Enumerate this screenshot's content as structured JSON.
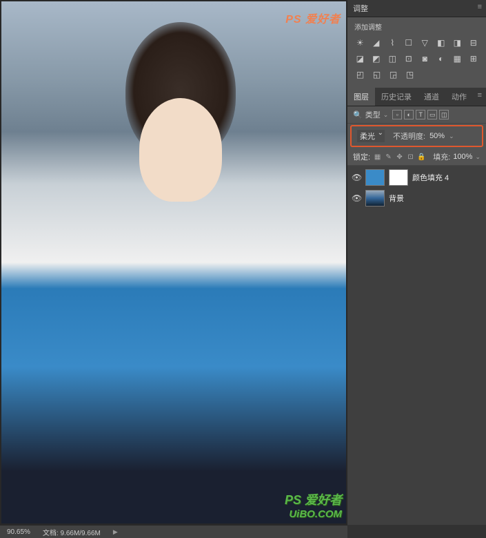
{
  "watermarks": {
    "top": "PS 爱好者",
    "mid": "PS 爱好者",
    "bottom": "UiBO.COM"
  },
  "adjustments": {
    "panel_title": "调整",
    "add_label": "添加调整",
    "icons_row1": [
      "brightness-icon",
      "levels-icon",
      "curves-icon",
      "exposure-icon",
      "vibrance-icon",
      "hue-icon",
      "bw-icon",
      "photo-filter-icon"
    ],
    "icons_row2": [
      "channel-mixer-icon",
      "color-lookup-icon",
      "invert-icon",
      "posterize-icon",
      "threshold-icon",
      "gradient-map-icon",
      "selective-color-icon",
      "box-icon"
    ],
    "icons_row3": [
      "box2-icon",
      "box3-icon",
      "box4-icon",
      "box5-icon"
    ]
  },
  "layers_panel": {
    "tabs": [
      "图层",
      "历史记录",
      "通道",
      "动作"
    ],
    "active_tab": 0,
    "filter_label": "类型",
    "blend_mode": "柔光",
    "opacity_label": "不透明度:",
    "opacity_value": "50%",
    "lock_label": "锁定:",
    "fill_label": "填充:",
    "fill_value": "100%",
    "layers": [
      {
        "name": "颜色填充 4",
        "type": "fill",
        "has_mask": true
      },
      {
        "name": "背景",
        "type": "image",
        "has_mask": false
      }
    ]
  },
  "status": {
    "zoom": "90.65%",
    "doc_label": "文档:",
    "doc_size": "9.66M/9.66M"
  }
}
